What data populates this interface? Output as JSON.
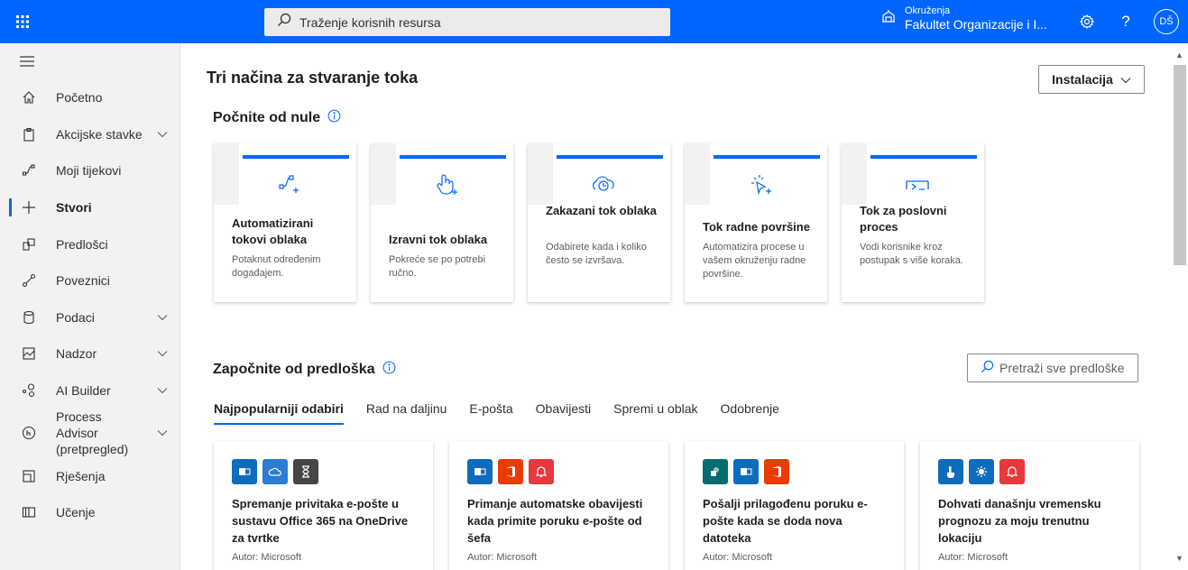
{
  "topbar": {
    "search_placeholder": "Traženje korisnih resursa",
    "env_label": "Okruženja",
    "env_value": "Fakultet Organizacije i I...",
    "avatar_initials": "DŠ",
    "help": "?",
    "accent": "#0066ff"
  },
  "sidebar": {
    "items": [
      {
        "label": "Početno",
        "icon": "home-icon"
      },
      {
        "label": "Akcijske stavke",
        "icon": "clipboard-icon",
        "chevron": true
      },
      {
        "label": "Moji tijekovi",
        "icon": "flow-icon"
      },
      {
        "label": "Stvori",
        "icon": "plus-icon",
        "active": true
      },
      {
        "label": "Predlošci",
        "icon": "templates-icon"
      },
      {
        "label": "Poveznici",
        "icon": "connector-icon"
      },
      {
        "label": "Podaci",
        "icon": "database-icon",
        "chevron": true
      },
      {
        "label": "Nadzor",
        "icon": "monitor-icon",
        "chevron": true
      },
      {
        "label": "AI Builder",
        "icon": "ai-builder-icon",
        "chevron": true
      },
      {
        "label": "Process Advisor (pretpregled)",
        "icon": "process-advisor-icon",
        "chevron": true
      },
      {
        "label": "Rješenja",
        "icon": "solutions-icon"
      },
      {
        "label": "Učenje",
        "icon": "book-icon"
      }
    ]
  },
  "main": {
    "title": "Tri načina za stvaranje toka",
    "install_label": "Instalacija",
    "blank_heading": "Počnite od nule",
    "cards": [
      {
        "title": "Automatizirani tokovi oblaka",
        "desc": "Potaknut određenim događajem.",
        "icon": "cloud-flow-icon"
      },
      {
        "title": "Izravni tok oblaka",
        "desc": "Pokreće se po potrebi ručno.",
        "icon": "touch-icon"
      },
      {
        "title": "Zakazani tok oblaka",
        "desc": "Odabirete kada i koliko često se izvršava.",
        "icon": "clock-cloud-icon"
      },
      {
        "title": "Tok radne površine",
        "desc": "Automatizira procese u vašem okruženju radne površine.",
        "icon": "desktop-cursor-icon"
      },
      {
        "title": "Tok za poslovni proces",
        "desc": "Vodi korisnike kroz postupak s više koraka.",
        "icon": "business-process-icon"
      }
    ],
    "template_heading": "Započnite od predloška",
    "template_search": "Pretraži sve predloške",
    "tabs": [
      "Najpopularniji odabiri",
      "Rad na daljinu",
      "E-pošta",
      "Obavijesti",
      "Spremi u oblak",
      "Odobrenje"
    ],
    "templates": [
      {
        "title": "Spremanje privitaka e-pošte u sustavu Office 365 na OneDrive za tvrtke",
        "author": "Autor: Microsoft",
        "icons": [
          {
            "name": "outlook-icon",
            "color": "#0f6cbd"
          },
          {
            "name": "onedrive-icon",
            "color": "#2b7cd3"
          },
          {
            "name": "hourglass-icon",
            "color": "#484644"
          }
        ]
      },
      {
        "title": "Primanje automatske obavijesti kada primite poruku e-pošte od šefa",
        "author": "Autor: Microsoft",
        "icons": [
          {
            "name": "outlook-icon",
            "color": "#0f6cbd"
          },
          {
            "name": "office-icon",
            "color": "#eb3c00"
          },
          {
            "name": "notification-icon",
            "color": "#e8383d"
          }
        ]
      },
      {
        "title": "Pošalji prilagođenu poruku e-pošte kada se doda nova datoteka",
        "author": "Autor: Microsoft",
        "icons": [
          {
            "name": "sharepoint-icon",
            "color": "#036c70"
          },
          {
            "name": "outlook-icon",
            "color": "#0f6cbd"
          },
          {
            "name": "office-icon",
            "color": "#eb3c00"
          }
        ]
      },
      {
        "title": "Dohvati današnju vremensku prognozu za moju trenutnu lokaciju",
        "author": "Autor: Microsoft",
        "icons": [
          {
            "name": "touch-button-icon",
            "color": "#0f6cbd"
          },
          {
            "name": "weather-icon",
            "color": "#0f6cbd"
          },
          {
            "name": "notification-icon",
            "color": "#e8383d"
          }
        ]
      }
    ]
  }
}
